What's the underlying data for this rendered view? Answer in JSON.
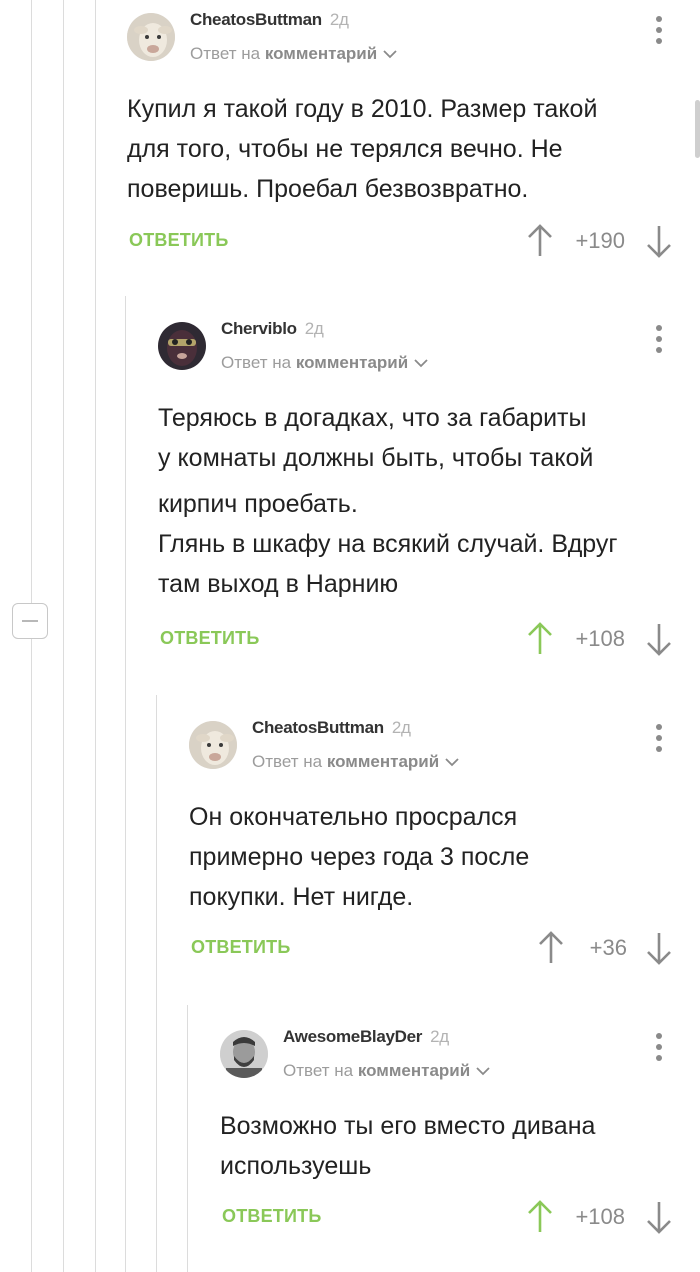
{
  "theme": {
    "accent": "#8ac858",
    "muted": "#9c9c9c",
    "arrow_default": "#8a8a8a"
  },
  "comments": [
    {
      "author": "CheatosButtman",
      "time": "2д",
      "reply_prefix": "Ответ на",
      "reply_target": "комментарий",
      "avatar": "sheep-avatar",
      "body": [
        "Купил я такой году в 2010. Размер такой",
        "для того, чтобы не терялся вечно. Не",
        "поверишь. Проебал безвозвратно."
      ],
      "reply_label": "ОТВЕТИТЬ",
      "score": "+190",
      "upvoted": false
    },
    {
      "author": "Cherviblo",
      "time": "2д",
      "reply_prefix": "Ответ на",
      "reply_target": "комментарий",
      "avatar": "masked-face-avatar",
      "body": [
        "Теряюсь в догадках, что за габариты",
        "у комнаты должны быть, чтобы такой",
        "кирпич проебать.",
        "Глянь в шкафу на всякий случай. Вдруг",
        "там выход в Нарнию"
      ],
      "reply_label": "ОТВЕТИТЬ",
      "score": "+108",
      "upvoted": true
    },
    {
      "author": "CheatosButtman",
      "time": "2д",
      "reply_prefix": "Ответ на",
      "reply_target": "комментарий",
      "avatar": "sheep-avatar",
      "body": [
        "Он окончательно просрался",
        "примерно через года 3 после",
        "покупки. Нет нигде."
      ],
      "reply_label": "ОТВЕТИТЬ",
      "score": "+36",
      "upvoted": false
    },
    {
      "author": "AwesomeBlayDer",
      "time": "2д",
      "reply_prefix": "Ответ на",
      "reply_target": "комментарий",
      "avatar": "bearded-man-avatar",
      "body": [
        "Возможно ты его вместо дивана",
        "используешь"
      ],
      "reply_label": "ОТВЕТИТЬ",
      "score": "+108",
      "upvoted": true
    }
  ]
}
